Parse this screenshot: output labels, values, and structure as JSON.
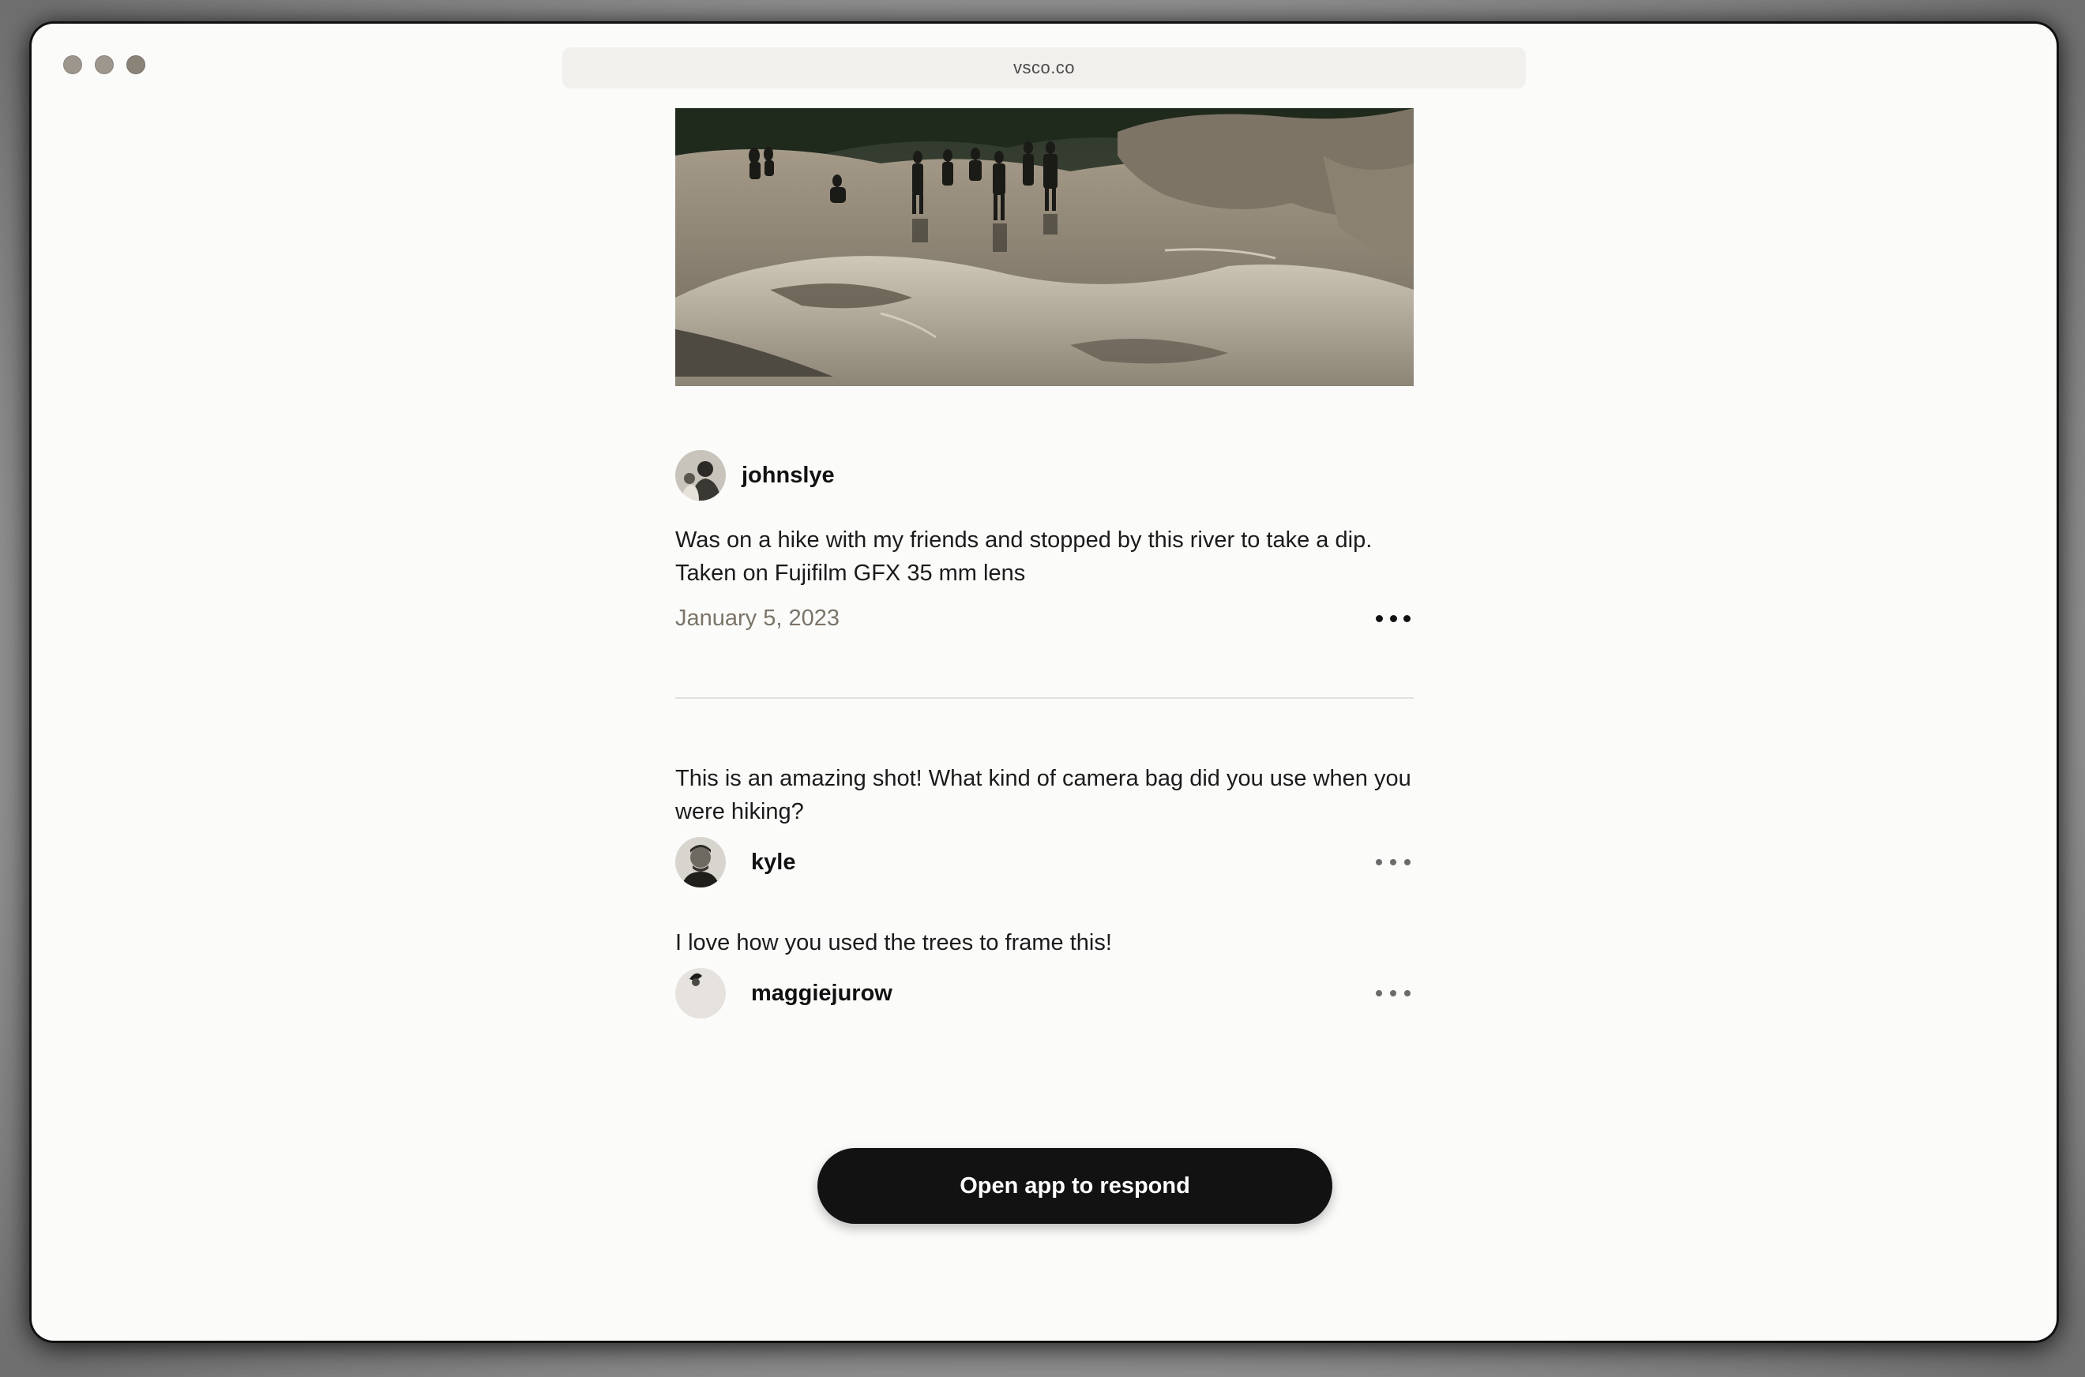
{
  "browser": {
    "url": "vsco.co"
  },
  "post": {
    "author": "johnslye",
    "caption": "Was on a hike with my friends and stopped by this river to take a dip.\nTaken on Fujifilm GFX 35 mm lens",
    "date": "January 5, 2023"
  },
  "comments": [
    {
      "text": "This is an amazing shot! What kind of camera bag did you use when you were hiking?",
      "author": "kyle"
    },
    {
      "text": "I love how you used the trees to frame this!",
      "author": "maggiejurow"
    }
  ],
  "cta": {
    "label": "Open app to respond"
  },
  "icons": {
    "more": "more-horizontal-icon"
  },
  "colors": {
    "cta_background": "#121212",
    "date_text": "#7b7468",
    "page_background": "#fbfbfa"
  }
}
